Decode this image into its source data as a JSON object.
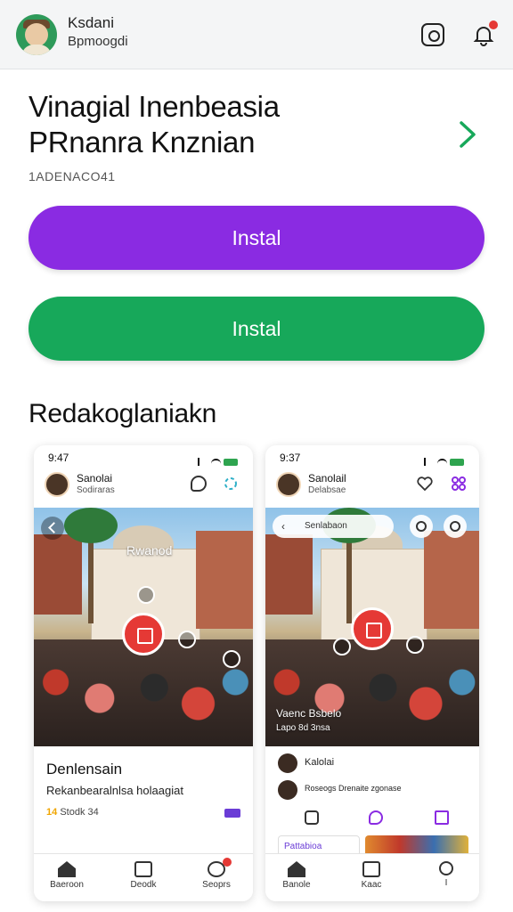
{
  "header": {
    "user_name": "Ksdani",
    "user_sub": "Bpmoogdi",
    "icons": [
      "camera-icon",
      "bell-icon"
    ]
  },
  "app": {
    "title_line1": "Vinagial Inenbeasia",
    "title_line2": "PRnanra Knznian",
    "meta": "1ADENACO41"
  },
  "buttons": {
    "install_primary": "Instal",
    "install_secondary": "Instal"
  },
  "section": {
    "title": "Redakoglaniakn"
  },
  "shot1": {
    "time": "9:47",
    "user_name": "Sanolai",
    "user_sub": "Sodiraras",
    "photo_caption": "Rwanod",
    "card_title": "Denlensain",
    "card_sub": "Rekanbearalnlsa holaagiat",
    "stat_num": "14",
    "stat_text": "Stodk 34",
    "nav": [
      "Baeroon",
      "Deodk",
      "Seoprs"
    ]
  },
  "shot2": {
    "time": "9:37",
    "user_name": "Sanolail",
    "user_sub": "Delabsae",
    "search_placeholder": "Senlabaon",
    "photo_caption": "Vaenc Bsbelo",
    "photo_sub": "Lapo 8d 3nsa",
    "person1": "Kalolai",
    "person2": "Roseogs Drenaite zgonase",
    "mini_card": "Pattabioa",
    "nav": [
      "Banole",
      "Kaac",
      "I"
    ]
  },
  "colors": {
    "purple": "#8a2be2",
    "green": "#17a85a",
    "record": "#e53935"
  }
}
